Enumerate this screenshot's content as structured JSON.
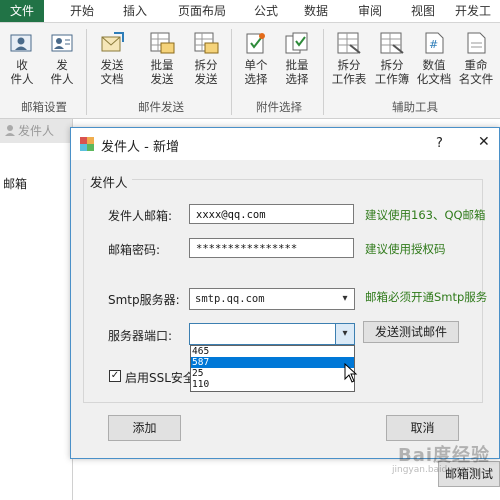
{
  "ribbon_tabs": [
    "文件",
    "开始",
    "插入",
    "页面布局",
    "公式",
    "数据",
    "审阅",
    "视图",
    "开发工"
  ],
  "ribbon": {
    "buttons": [
      {
        "line1": "收",
        "line2": "件人",
        "icon": "inbox-user-icon"
      },
      {
        "line1": "发",
        "line2": "件人",
        "icon": "sender-card-icon"
      },
      {
        "line1": "发送",
        "line2": "文档",
        "icon": "send-document-icon"
      },
      {
        "line1": "批量",
        "line2": "发送",
        "icon": "batch-send-icon"
      },
      {
        "line1": "拆分",
        "line2": "发送",
        "icon": "split-send-icon"
      },
      {
        "line1": "单个",
        "line2": "选择",
        "icon": "single-select-icon"
      },
      {
        "line1": "批量",
        "line2": "选择",
        "icon": "batch-select-icon"
      },
      {
        "line1": "拆分",
        "line2": "工作表",
        "icon": "split-sheet-icon"
      },
      {
        "line1": "拆分",
        "line2": "工作簿",
        "icon": "split-workbook-icon"
      },
      {
        "line1": "数值",
        "line2": "化文档",
        "icon": "numeric-document-icon"
      },
      {
        "line1": "重命",
        "line2": "名文件",
        "icon": "rename-file-icon"
      }
    ],
    "groups": [
      "邮箱设置",
      "邮件发送",
      "附件选择",
      "辅助工具"
    ]
  },
  "side_panel": {
    "title": "发件人",
    "item": "邮箱"
  },
  "dialog": {
    "title": "发件人 - 新增",
    "help": "?",
    "close": "✕",
    "group_label": "发件人",
    "email_label": "发件人邮箱:",
    "email_value": "xxxx@qq.com",
    "email_hint": "建议使用163、QQ邮箱",
    "password_label": "邮箱密码:",
    "password_value": "****************",
    "password_hint": "建议使用授权码",
    "smtp_label": "Smtp服务器:",
    "smtp_value": "smtp.qq.com",
    "smtp_hint": "邮箱必须开通Smtp服务",
    "port_label": "服务器端口:",
    "port_value": "",
    "port_options": [
      "465",
      "587",
      "25",
      "110"
    ],
    "port_highlighted": "587",
    "test_button": "发送测试邮件",
    "ssl_label": "启用SSL安全",
    "add_button": "添加",
    "cancel_button": "取消"
  },
  "background_button": "邮箱测试",
  "watermark": {
    "line1": "Bai度经验",
    "line2": "jingyan.baidu.com"
  },
  "colors": {
    "file_tab": "#217346",
    "hint_green": "#2f7a1a",
    "selection": "#0078d7",
    "dialog_border": "#4a90c8"
  }
}
